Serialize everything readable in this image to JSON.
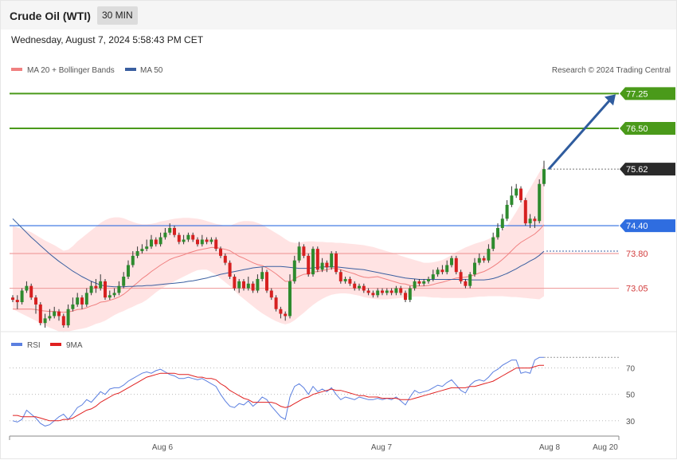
{
  "header": {
    "title": "Crude Oil (WTI)",
    "timeframe": "30 MIN"
  },
  "datetime": "Wednesday, August 7, 2024 5:58:43 PM CET",
  "legend": {
    "bb": "MA 20 + Bollinger Bands",
    "ma50": "MA 50",
    "credit": "Research © 2024 Trading Central",
    "rsi": "RSI",
    "rsi_ma": "9MA"
  },
  "colors": {
    "up": "#2e8b2e",
    "down": "#d62020",
    "band": "#ffd9d9",
    "ma20": "#f08080",
    "ma50": "#3a5fa0",
    "green_level": "#4a9a1a",
    "blue_level": "#2f6de0",
    "red_level": "#f0a0a0",
    "rsi": "#5b7fe0",
    "rsi_ma": "#e02020",
    "current": "#2a2a2a"
  },
  "chart_data": {
    "type": "candlestick",
    "y_range": [
      72.2,
      77.6
    ],
    "levels": [
      {
        "value": 77.25,
        "label": "77.25",
        "kind": "green"
      },
      {
        "value": 76.5,
        "label": "76.50",
        "kind": "green"
      },
      {
        "value": 75.62,
        "label": "75.62",
        "kind": "current"
      },
      {
        "value": 74.4,
        "label": "74.40",
        "kind": "blue"
      },
      {
        "value": 73.8,
        "label": "73.80",
        "kind": "red"
      },
      {
        "value": 73.05,
        "label": "73.05",
        "kind": "red"
      }
    ],
    "x_labels": [
      "Aug 6",
      "Aug 7",
      "Aug 8",
      "Aug 20"
    ],
    "candles": [
      [
        72.85,
        72.8,
        72.9,
        72.75
      ],
      [
        72.8,
        72.75,
        72.9,
        72.6
      ],
      [
        72.75,
        73.0,
        73.05,
        72.7
      ],
      [
        73.0,
        73.1,
        73.2,
        72.95
      ],
      [
        73.1,
        72.85,
        73.15,
        72.8
      ],
      [
        72.85,
        72.7,
        72.9,
        72.5
      ],
      [
        72.7,
        72.3,
        72.75,
        72.25
      ],
      [
        72.3,
        72.4,
        72.5,
        72.2
      ],
      [
        72.4,
        72.45,
        72.6,
        72.35
      ],
      [
        72.45,
        72.55,
        72.65,
        72.4
      ],
      [
        72.55,
        72.45,
        72.6,
        72.35
      ],
      [
        72.45,
        72.25,
        72.5,
        72.2
      ],
      [
        72.25,
        72.6,
        72.7,
        72.2
      ],
      [
        72.6,
        72.7,
        72.85,
        72.55
      ],
      [
        72.7,
        72.85,
        72.95,
        72.65
      ],
      [
        72.85,
        72.7,
        72.9,
        72.6
      ],
      [
        72.7,
        72.95,
        73.05,
        72.65
      ],
      [
        72.95,
        73.1,
        73.2,
        72.9
      ],
      [
        73.1,
        73.05,
        73.25,
        72.95
      ],
      [
        73.05,
        73.2,
        73.35,
        73.0
      ],
      [
        73.2,
        72.85,
        73.25,
        72.8
      ],
      [
        72.85,
        72.9,
        73.0,
        72.8
      ],
      [
        72.9,
        72.95,
        73.05,
        72.85
      ],
      [
        72.95,
        73.1,
        73.2,
        72.9
      ],
      [
        73.1,
        73.3,
        73.4,
        73.05
      ],
      [
        73.3,
        73.55,
        73.65,
        73.25
      ],
      [
        73.55,
        73.75,
        73.85,
        73.5
      ],
      [
        73.75,
        73.85,
        73.95,
        73.7
      ],
      [
        73.85,
        73.9,
        74.0,
        73.8
      ],
      [
        73.9,
        73.95,
        74.1,
        73.85
      ],
      [
        73.95,
        74.1,
        74.2,
        73.9
      ],
      [
        74.1,
        74.0,
        74.15,
        73.95
      ],
      [
        74.0,
        74.15,
        74.25,
        73.95
      ],
      [
        74.15,
        74.25,
        74.35,
        74.1
      ],
      [
        74.25,
        74.35,
        74.45,
        74.2
      ],
      [
        74.35,
        74.2,
        74.4,
        74.15
      ],
      [
        74.2,
        74.05,
        74.25,
        74.0
      ],
      [
        74.05,
        74.1,
        74.2,
        74.0
      ],
      [
        74.1,
        74.2,
        74.25,
        74.05
      ],
      [
        74.2,
        74.1,
        74.25,
        74.05
      ],
      [
        74.1,
        74.0,
        74.15,
        73.95
      ],
      [
        74.0,
        74.1,
        74.2,
        73.95
      ],
      [
        74.1,
        74.05,
        74.15,
        74.0
      ],
      [
        74.05,
        74.1,
        74.15,
        74.0
      ],
      [
        74.1,
        73.9,
        74.15,
        73.85
      ],
      [
        73.9,
        73.75,
        73.95,
        73.7
      ],
      [
        73.75,
        73.6,
        73.8,
        73.55
      ],
      [
        73.6,
        73.3,
        73.65,
        73.25
      ],
      [
        73.3,
        73.05,
        73.35,
        73.0
      ],
      [
        73.05,
        73.2,
        73.25,
        72.95
      ],
      [
        73.2,
        73.05,
        73.25,
        73.0
      ],
      [
        73.05,
        73.15,
        73.3,
        73.0
      ],
      [
        73.15,
        73.0,
        73.2,
        72.95
      ],
      [
        73.0,
        73.25,
        73.35,
        72.95
      ],
      [
        73.25,
        73.4,
        73.5,
        73.2
      ],
      [
        73.4,
        73.0,
        73.45,
        72.95
      ],
      [
        73.0,
        72.85,
        73.05,
        72.8
      ],
      [
        72.85,
        72.6,
        72.9,
        72.55
      ],
      [
        72.6,
        72.5,
        72.65,
        72.4
      ],
      [
        72.5,
        72.45,
        72.55,
        72.35
      ],
      [
        72.45,
        73.2,
        73.35,
        72.4
      ],
      [
        73.2,
        73.65,
        73.75,
        73.15
      ],
      [
        73.65,
        73.95,
        74.05,
        73.6
      ],
      [
        73.95,
        73.75,
        74.0,
        73.7
      ],
      [
        73.75,
        73.35,
        73.8,
        73.3
      ],
      [
        73.35,
        73.9,
        73.95,
        73.3
      ],
      [
        73.9,
        73.45,
        73.95,
        73.4
      ],
      [
        73.45,
        73.6,
        73.7,
        73.4
      ],
      [
        73.6,
        73.5,
        73.65,
        73.4
      ],
      [
        73.5,
        73.8,
        73.85,
        73.45
      ],
      [
        73.8,
        73.4,
        73.85,
        73.35
      ],
      [
        73.4,
        73.2,
        73.45,
        73.15
      ],
      [
        73.2,
        73.25,
        73.3,
        73.15
      ],
      [
        73.25,
        73.15,
        73.3,
        73.1
      ],
      [
        73.15,
        73.05,
        73.2,
        73.0
      ],
      [
        73.05,
        73.1,
        73.15,
        73.0
      ],
      [
        73.1,
        73.0,
        73.15,
        72.95
      ],
      [
        73.0,
        72.95,
        73.05,
        72.9
      ],
      [
        72.95,
        72.9,
        73.0,
        72.85
      ],
      [
        72.9,
        73.0,
        73.05,
        72.85
      ],
      [
        73.0,
        72.95,
        73.05,
        72.9
      ],
      [
        72.95,
        73.0,
        73.05,
        72.9
      ],
      [
        73.0,
        72.95,
        73.05,
        72.9
      ],
      [
        72.95,
        73.05,
        73.1,
        72.9
      ],
      [
        73.05,
        72.95,
        73.1,
        72.9
      ],
      [
        72.95,
        72.8,
        73.0,
        72.75
      ],
      [
        72.8,
        73.05,
        73.1,
        72.75
      ],
      [
        73.05,
        73.2,
        73.25,
        73.0
      ],
      [
        73.2,
        73.15,
        73.25,
        73.1
      ],
      [
        73.15,
        73.2,
        73.25,
        73.1
      ],
      [
        73.2,
        73.25,
        73.3,
        73.15
      ],
      [
        73.25,
        73.35,
        73.45,
        73.2
      ],
      [
        73.35,
        73.45,
        73.5,
        73.3
      ],
      [
        73.45,
        73.4,
        73.55,
        73.35
      ],
      [
        73.4,
        73.55,
        73.65,
        73.35
      ],
      [
        73.55,
        73.7,
        73.75,
        73.5
      ],
      [
        73.7,
        73.4,
        73.75,
        73.35
      ],
      [
        73.4,
        73.2,
        73.45,
        73.15
      ],
      [
        73.2,
        73.1,
        73.25,
        73.05
      ],
      [
        73.1,
        73.35,
        73.4,
        73.05
      ],
      [
        73.35,
        73.6,
        73.7,
        73.3
      ],
      [
        73.6,
        73.7,
        73.8,
        73.55
      ],
      [
        73.7,
        73.65,
        73.75,
        73.6
      ],
      [
        73.65,
        73.9,
        74.0,
        73.6
      ],
      [
        73.9,
        74.15,
        74.25,
        73.85
      ],
      [
        74.15,
        74.35,
        74.45,
        74.1
      ],
      [
        74.35,
        74.55,
        74.65,
        74.3
      ],
      [
        74.55,
        74.85,
        74.95,
        74.5
      ],
      [
        74.85,
        75.05,
        75.25,
        74.8
      ],
      [
        75.05,
        75.2,
        75.3,
        75.0
      ],
      [
        75.2,
        74.95,
        75.25,
        74.9
      ],
      [
        74.95,
        74.45,
        75.0,
        74.4
      ],
      [
        74.45,
        74.55,
        74.65,
        74.35
      ],
      [
        74.55,
        74.5,
        74.6,
        74.35
      ],
      [
        74.5,
        75.3,
        75.4,
        74.45
      ],
      [
        75.3,
        75.62,
        75.8,
        75.25
      ]
    ],
    "ma20": [
      72.6,
      72.6,
      72.6,
      72.6,
      72.6,
      72.59,
      72.57,
      72.56,
      72.55,
      72.55,
      72.54,
      72.53,
      72.54,
      72.56,
      72.59,
      72.6,
      72.63,
      72.67,
      72.7,
      72.75,
      72.76,
      72.79,
      72.82,
      72.86,
      72.92,
      73.0,
      73.09,
      73.17,
      73.26,
      73.33,
      73.41,
      73.48,
      73.55,
      73.61,
      73.67,
      73.71,
      73.74,
      73.77,
      73.81,
      73.84,
      73.87,
      73.89,
      73.91,
      73.93,
      73.93,
      73.91,
      73.89,
      73.86,
      73.8,
      73.74,
      73.7,
      73.65,
      73.6,
      73.56,
      73.54,
      73.49,
      73.43,
      73.36,
      73.28,
      73.2,
      73.2,
      73.25,
      73.31,
      73.35,
      73.36,
      73.4,
      73.41,
      73.43,
      73.45,
      73.48,
      73.48,
      73.45,
      73.42,
      73.39,
      73.36,
      73.32,
      73.29,
      73.28,
      73.29,
      73.3,
      73.27,
      73.24,
      73.21,
      73.18,
      73.15,
      73.14,
      73.11,
      73.1,
      73.1,
      73.1,
      73.11,
      73.13,
      73.16,
      73.18,
      73.21,
      73.24,
      73.27,
      73.28,
      73.29,
      73.31,
      73.34,
      73.38,
      73.41,
      73.46,
      73.52,
      73.59,
      73.67,
      73.76,
      73.86,
      73.96,
      74.04,
      74.1,
      74.16,
      74.22,
      74.31,
      74.42
    ],
    "bb_upper": [
      74.4,
      74.36,
      74.33,
      74.3,
      74.26,
      74.2,
      74.14,
      74.08,
      74.03,
      73.98,
      73.92,
      73.86,
      73.88,
      73.96,
      74.06,
      74.14,
      74.22,
      74.3,
      74.38,
      74.46,
      74.52,
      74.56,
      74.58,
      74.58,
      74.56,
      74.52,
      74.48,
      74.45,
      74.43,
      74.43,
      74.44,
      74.46,
      74.49,
      74.51,
      74.53,
      74.55,
      74.56,
      74.57,
      74.57,
      74.56,
      74.55,
      74.53,
      74.5,
      74.47,
      74.44,
      74.42,
      74.4,
      74.4,
      74.44,
      74.48,
      74.5,
      74.5,
      74.49,
      74.46,
      74.42,
      74.36,
      74.3,
      74.24,
      74.18,
      74.11,
      74.05,
      74.03,
      74.03,
      74.05,
      74.06,
      74.06,
      74.05,
      74.05,
      74.04,
      74.04,
      74.03,
      74.03,
      74.02,
      74.01,
      74.0,
      73.99,
      73.98,
      73.96,
      73.94,
      73.91,
      73.88,
      73.85,
      73.82,
      73.79,
      73.75,
      73.72,
      73.69,
      73.66,
      73.63,
      73.6,
      73.6,
      73.61,
      73.63,
      73.66,
      73.71,
      73.77,
      73.83,
      73.88,
      73.93,
      73.97,
      74.01,
      74.04,
      74.07,
      74.11,
      74.16,
      74.23,
      74.31,
      74.4,
      74.54,
      74.7,
      74.87,
      75.04,
      75.21,
      75.38,
      75.55,
      75.72
    ],
    "bb_lower": [
      72.6,
      72.55,
      72.5,
      72.45,
      72.4,
      72.35,
      72.3,
      72.25,
      72.2,
      72.16,
      72.12,
      72.1,
      72.12,
      72.14,
      72.16,
      72.18,
      72.2,
      72.24,
      72.28,
      72.31,
      72.35,
      72.41,
      72.47,
      72.52,
      72.56,
      72.61,
      72.65,
      72.7,
      72.74,
      72.8,
      72.88,
      72.96,
      73.03,
      73.09,
      73.14,
      73.2,
      73.25,
      73.3,
      73.35,
      73.4,
      73.44,
      73.45,
      73.45,
      73.4,
      73.34,
      73.26,
      73.18,
      73.1,
      73.0,
      72.9,
      72.82,
      72.74,
      72.66,
      72.58,
      72.51,
      72.45,
      72.39,
      72.34,
      72.3,
      72.27,
      72.3,
      72.36,
      72.44,
      72.52,
      72.61,
      72.69,
      72.76,
      72.82,
      72.87,
      72.91,
      72.93,
      72.94,
      72.94,
      72.93,
      72.91,
      72.89,
      72.86,
      72.84,
      72.82,
      72.81,
      72.81,
      72.81,
      72.82,
      72.83,
      72.84,
      72.85,
      72.86,
      72.87,
      72.87,
      72.87,
      72.86,
      72.85,
      72.85,
      72.84,
      72.84,
      72.84,
      72.84,
      72.84,
      72.84,
      72.85,
      72.86,
      72.87,
      72.87,
      72.88,
      72.88,
      72.88,
      72.88,
      72.87,
      72.86,
      72.86,
      72.85,
      72.84,
      72.83,
      72.82,
      72.81,
      72.88
    ],
    "ma50": [
      74.55,
      74.45,
      74.35,
      74.25,
      74.15,
      74.06,
      73.97,
      73.88,
      73.79,
      73.71,
      73.63,
      73.56,
      73.49,
      73.42,
      73.36,
      73.3,
      73.25,
      73.2,
      73.16,
      73.12,
      73.1,
      73.09,
      73.08,
      73.08,
      73.08,
      73.09,
      73.09,
      73.1,
      73.1,
      73.11,
      73.11,
      73.12,
      73.13,
      73.14,
      73.15,
      73.16,
      73.17,
      73.18,
      73.2,
      73.21,
      73.23,
      73.25,
      73.27,
      73.3,
      73.32,
      73.35,
      73.37,
      73.39,
      73.41,
      73.43,
      73.45,
      73.47,
      73.49,
      73.5,
      73.51,
      73.52,
      73.52,
      73.52,
      73.52,
      73.51,
      73.5,
      73.49,
      73.48,
      73.48,
      73.48,
      73.49,
      73.5,
      73.51,
      73.51,
      73.51,
      73.51,
      73.5,
      73.49,
      73.48,
      73.47,
      73.46,
      73.45,
      73.43,
      73.41,
      73.39,
      73.37,
      73.35,
      73.33,
      73.31,
      73.29,
      73.27,
      73.26,
      73.25,
      73.24,
      73.24,
      73.24,
      73.24,
      73.24,
      73.24,
      73.24,
      73.24,
      73.24,
      73.24,
      73.24,
      73.23,
      73.23,
      73.23,
      73.23,
      73.24,
      73.26,
      73.29,
      73.33,
      73.37,
      73.42,
      73.47,
      73.53,
      73.58,
      73.64,
      73.69,
      73.76,
      73.85
    ],
    "rsi_ticks": [
      70,
      50,
      30
    ],
    "rsi_range": [
      22,
      80
    ],
    "rsi": [
      30,
      29,
      31,
      38,
      35,
      32,
      28,
      26,
      27,
      30,
      33,
      35,
      31,
      35,
      40,
      42,
      46,
      44,
      48,
      52,
      50,
      54,
      55,
      55,
      57,
      60,
      62,
      64,
      66,
      67,
      66,
      68,
      69,
      67,
      65,
      64,
      62,
      62,
      63,
      62,
      61,
      62,
      60,
      58,
      56,
      50,
      45,
      41,
      40,
      43,
      42,
      45,
      41,
      44,
      48,
      46,
      41,
      37,
      33,
      31,
      48,
      56,
      58,
      55,
      50,
      56,
      52,
      54,
      52,
      55,
      50,
      46,
      48,
      47,
      46,
      48,
      47,
      46,
      46,
      47,
      46,
      47,
      46,
      48,
      45,
      42,
      48,
      53,
      51,
      52,
      53,
      55,
      57,
      56,
      59,
      61,
      57,
      53,
      51,
      57,
      60,
      61,
      60,
      63,
      67,
      69,
      72,
      74,
      76,
      76,
      66,
      67,
      66,
      76,
      78,
      78
    ],
    "rsi_ma": [
      34,
      34,
      33,
      33,
      33,
      33,
      32,
      31,
      30,
      30,
      30,
      31,
      31,
      32,
      34,
      36,
      38,
      39,
      41,
      44,
      46,
      48,
      50,
      51,
      53,
      55,
      57,
      59,
      61,
      63,
      64,
      65,
      66,
      66,
      66,
      66,
      65,
      65,
      65,
      64,
      63,
      63,
      62,
      62,
      61,
      58,
      56,
      53,
      51,
      49,
      47,
      46,
      44,
      44,
      44,
      44,
      44,
      43,
      41,
      40,
      41,
      43,
      45,
      47,
      48,
      50,
      51,
      52,
      53,
      54,
      53,
      53,
      52,
      51,
      50,
      49,
      49,
      48,
      48,
      48,
      47,
      47,
      47,
      47,
      46,
      46,
      46,
      47,
      48,
      49,
      50,
      51,
      52,
      53,
      54,
      55,
      55,
      55,
      55,
      56,
      56,
      57,
      58,
      59,
      60,
      62,
      64,
      66,
      68,
      70,
      70,
      70,
      70,
      71,
      72,
      72
    ]
  }
}
